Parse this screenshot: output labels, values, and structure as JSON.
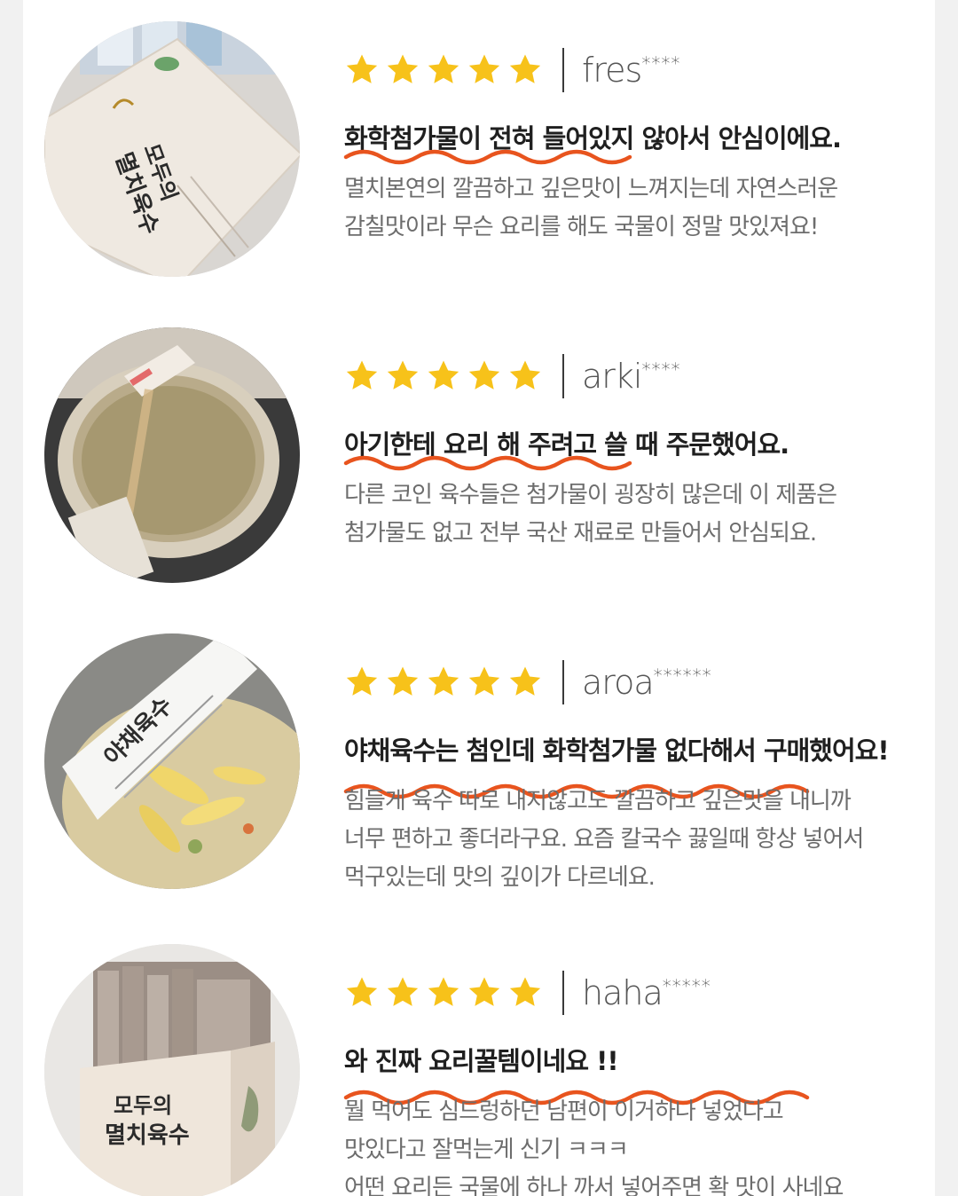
{
  "colors": {
    "star": "#f7c21a",
    "underline": "#e8541e",
    "title": "#1f1f1f",
    "body": "#6d6d6d"
  },
  "reviews": [
    {
      "rating": 5,
      "user": "fres",
      "user_mask": "****",
      "photo_text": [
        "모두의",
        "멸치육수"
      ],
      "title": "화학첨가물이 전혀 들어있지 않아서 안심이에요.",
      "lines": [
        "멸치본연의 깔끔하고 깊은맛이 느껴지는데 자연스러운",
        "감칠맛이라 무슨 요리를 해도 국물이 정말 맛있져요!"
      ]
    },
    {
      "rating": 5,
      "user": "arki",
      "user_mask": "****",
      "photo_text": [],
      "title": "아기한테 요리 해 주려고 쓸 때 주문했어요.",
      "lines": [
        "다른 코인 육수들은 첨가물이 굉장히 많은데 이 제품은",
        "첨가물도 없고 전부 국산 재료로 만들어서 안심되요."
      ]
    },
    {
      "rating": 5,
      "user": "aroa",
      "user_mask": "******",
      "photo_text": [
        "야채육수"
      ],
      "title": "야채육수는 첨인데 화학첨가물 없다해서 구매했어요!",
      "lines": [
        "힘들게 육수 따로 내지않고도 깔끔하고 깊은맛을 내니까",
        "너무 편하고 좋더라구요. 요즘 칼국수 끓일때 항상 넣어서",
        "먹구있는데 맛의 깊이가 다르네요."
      ]
    },
    {
      "rating": 5,
      "user": "haha",
      "user_mask": "*****",
      "photo_text": [
        "모두의",
        "멸치육수"
      ],
      "title": "와 진짜 요리꿀템이네요 !!",
      "lines": [
        "뭘 먹어도 심드렁하던 남편이 이거하나 넣었다고",
        "맛있다고 잘먹는게 신기 ㅋㅋㅋ",
        "어떤 요리든 국물에 하나 까서 넣어주면 확 맛이 사네요"
      ]
    }
  ]
}
